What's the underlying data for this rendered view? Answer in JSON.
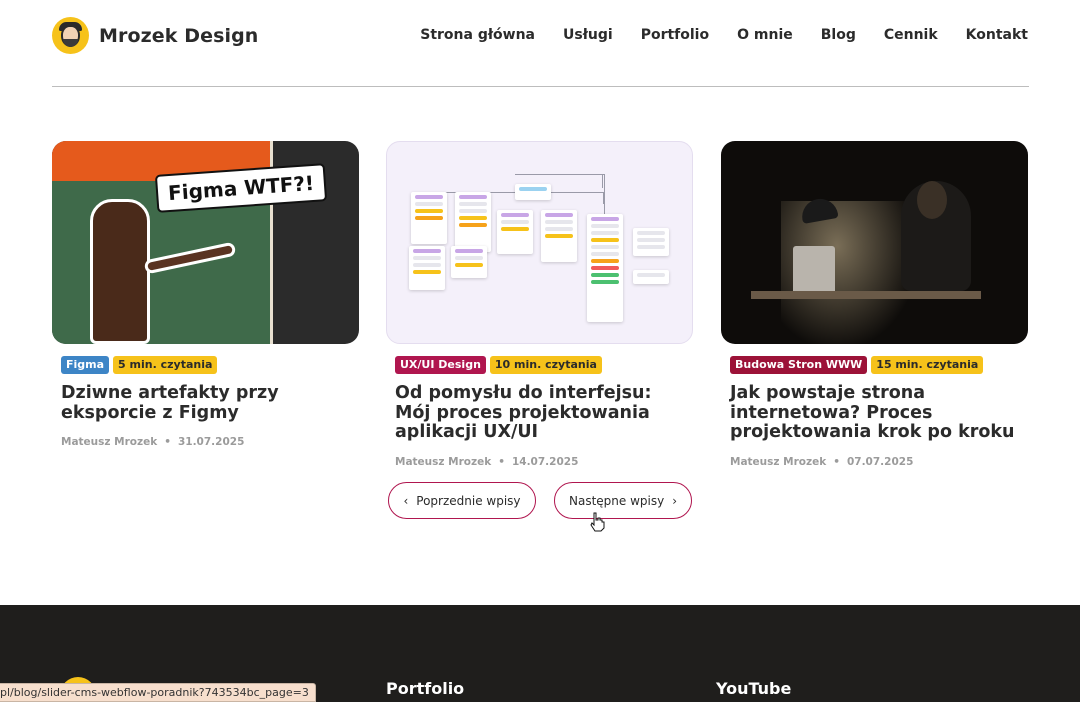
{
  "header": {
    "brand": "Mrozek Design",
    "nav": [
      "Strona główna",
      "Usługi",
      "Portfolio",
      "O mnie",
      "Blog",
      "Cennik",
      "Kontakt"
    ]
  },
  "posts": [
    {
      "thumbnail_text": "Figma WTF?!",
      "category": "Figma",
      "category_color": "#3d85c6",
      "read_time": "5 min. czytania",
      "title": "Dziwne artefakty przy eksporcie z Figmy",
      "author": "Mateusz Mrozek",
      "date": "31.07.2025"
    },
    {
      "category": "UX/UI Design",
      "category_color": "#b0164f",
      "read_time": "10 min. czytania",
      "title": "Od pomysłu do interfejsu: Mój proces projektowania aplikacji UX/UI",
      "author": "Mateusz Mrozek",
      "date": "14.07.2025"
    },
    {
      "category": "Budowa Stron WWW",
      "category_color": "#9c1238",
      "read_time": "15 min. czytania",
      "title": "Jak powstaje strona internetowa? Proces projektowania krok po kroku",
      "author": "Mateusz Mrozek",
      "date": "07.07.2025"
    }
  ],
  "meta_separator": "•",
  "pagination": {
    "prev_label": "Poprzednie wpisy",
    "next_label": "Następne wpisy",
    "prev_icon": "chevron-left-icon",
    "next_icon": "chevron-right-icon"
  },
  "footer": {
    "headings": [
      "Portfolio",
      "YouTube"
    ]
  },
  "status_bar": {
    "url": "pl/blog/slider-cms-webflow-poradnik?743534bc_page=3"
  },
  "colors": {
    "accent": "#b0164f",
    "tag_yellow": "#f6c21a",
    "footer_bg": "#1f1e1c"
  }
}
